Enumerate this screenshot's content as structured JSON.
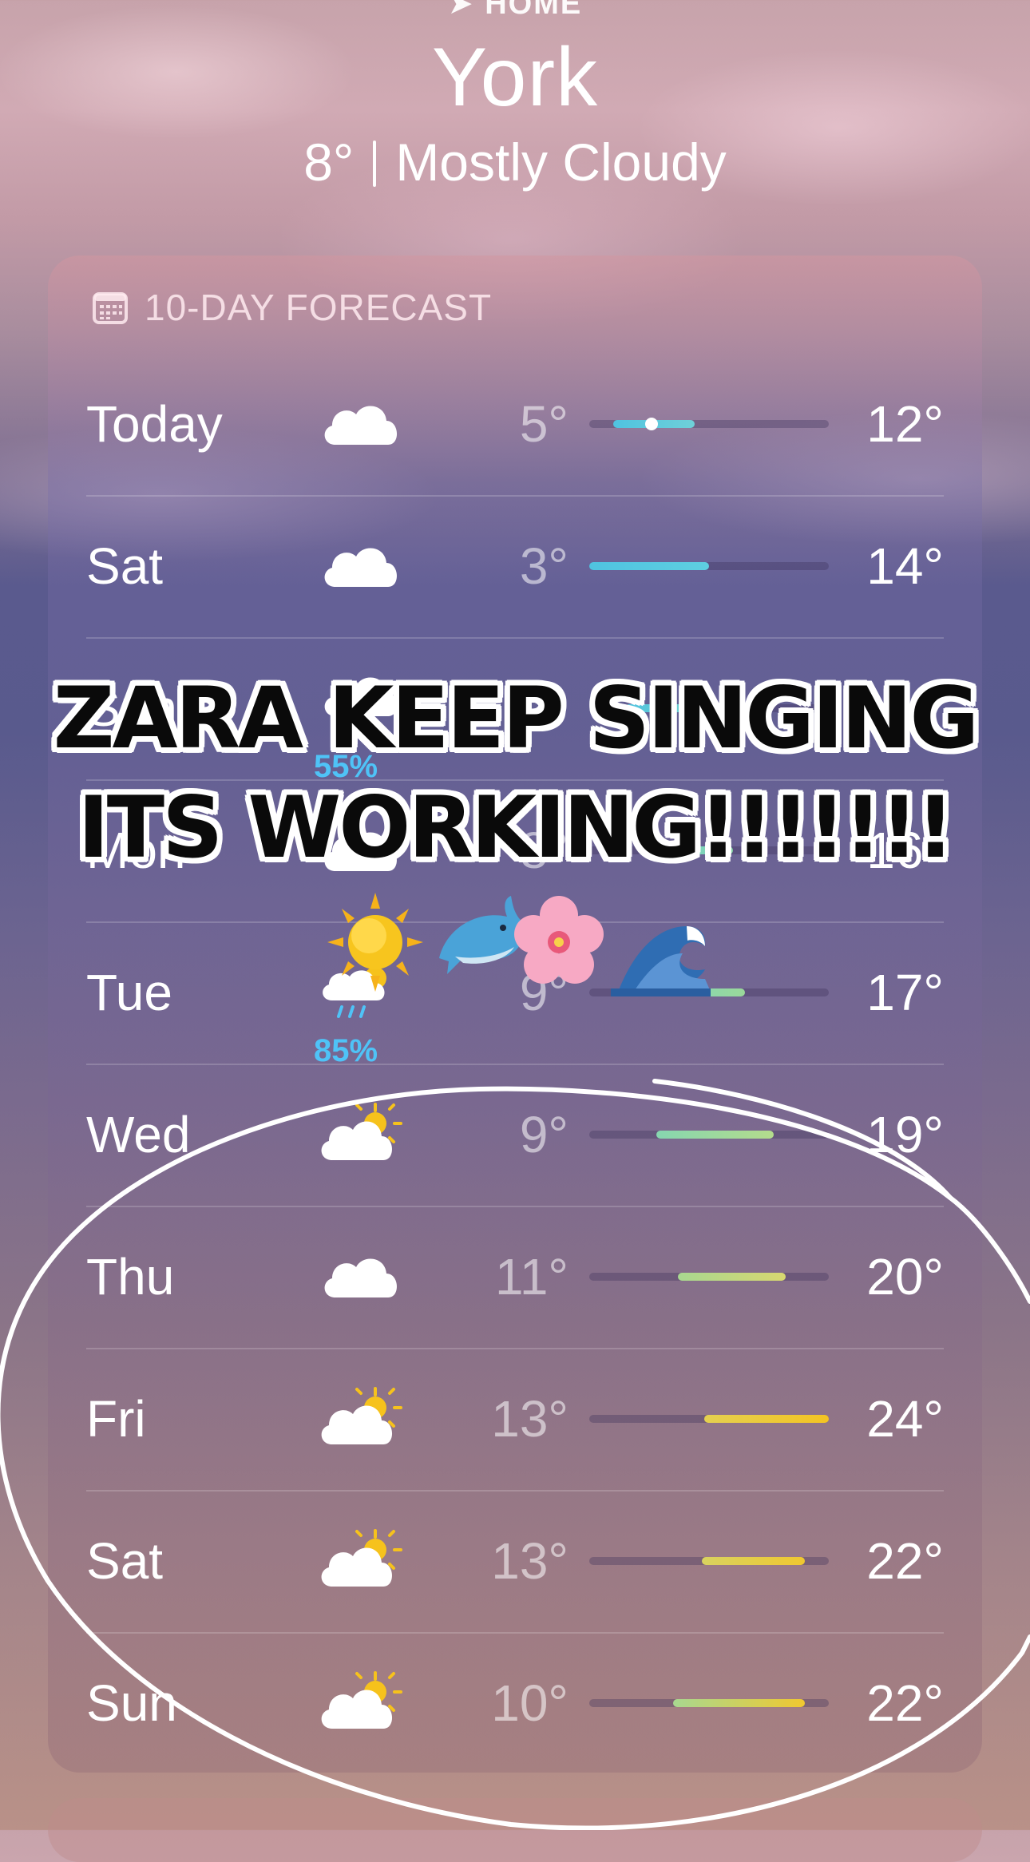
{
  "header": {
    "location_label": "HOME",
    "city": "York",
    "current_temp": "8°",
    "condition": "Mostly Cloudy"
  },
  "forecast": {
    "title": "10-DAY FORECAST",
    "days": [
      {
        "day": "Today",
        "icon": "cloud-icon",
        "low": "5°",
        "high": "12°",
        "range_start": 0.1,
        "range_end": 0.44,
        "bar_colors": [
          "#4fc3e0",
          "#6fd0d8"
        ],
        "current_marker": 0.26
      },
      {
        "day": "Sat",
        "icon": "cloud-icon",
        "low": "3°",
        "high": "14°",
        "range_start": 0.0,
        "range_end": 0.5,
        "bar_colors": [
          "#4fc3e0",
          "#5ecfe0"
        ]
      },
      {
        "day": "Sun",
        "icon": "rain-cloud-icon",
        "low": "",
        "high": "",
        "precip": "55%",
        "range_start": 0.15,
        "range_end": 0.55,
        "bar_colors": [
          "#4fc3e0",
          "#7dd5c6"
        ]
      },
      {
        "day": "Mon",
        "icon": "cloud-icon",
        "low": "8°",
        "high": "16°",
        "range_start": 0.25,
        "range_end": 0.6,
        "bar_colors": [
          "#6fd0d8",
          "#88d6a8"
        ]
      },
      {
        "day": "Tue",
        "icon": "sun-rain-cloud-icon",
        "low": "9°",
        "high": "17°",
        "precip": "85%",
        "range_start": 0.28,
        "range_end": 0.65,
        "bar_colors": [
          "#7dd5c0",
          "#9ad89a"
        ]
      },
      {
        "day": "Wed",
        "icon": "partly-sunny-icon",
        "low": "9°",
        "high": "19°",
        "range_start": 0.28,
        "range_end": 0.77,
        "bar_colors": [
          "#86d6b0",
          "#b4dc8c"
        ]
      },
      {
        "day": "Thu",
        "icon": "cloud-icon",
        "low": "11°",
        "high": "20°",
        "range_start": 0.37,
        "range_end": 0.82,
        "bar_colors": [
          "#a8d890",
          "#d8d870"
        ]
      },
      {
        "day": "Fri",
        "icon": "partly-sunny-icon",
        "low": "13°",
        "high": "24°",
        "range_start": 0.48,
        "range_end": 1.0,
        "bar_colors": [
          "#e4d050",
          "#f3c423"
        ]
      },
      {
        "day": "Sat",
        "icon": "partly-sunny-icon",
        "low": "13°",
        "high": "22°",
        "range_start": 0.47,
        "range_end": 0.9,
        "bar_colors": [
          "#d8d260",
          "#f0c830"
        ]
      },
      {
        "day": "Sun",
        "icon": "partly-sunny-icon",
        "low": "10°",
        "high": "22°",
        "range_start": 0.35,
        "range_end": 0.9,
        "bar_colors": [
          "#a8d890",
          "#f0c830"
        ]
      }
    ]
  },
  "overlay": {
    "line1": "ZARA KEEP SINGING",
    "line2": "ITS WORKING!!!!!!!",
    "emojis": [
      "sun-emoji",
      "dolphin-emoji",
      "cherry-blossom-emoji",
      "wave-emoji"
    ]
  },
  "colors": {
    "text": "#ffffff",
    "precip": "#4fc3f7",
    "annotation": "#ffffff"
  }
}
